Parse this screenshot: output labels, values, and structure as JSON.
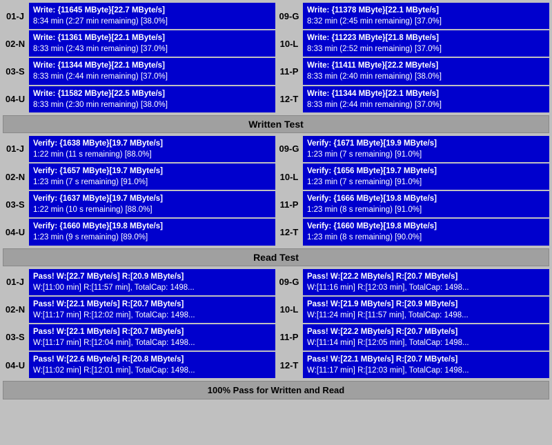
{
  "sections": {
    "write_test": {
      "header": "Written Test",
      "left_devices": [
        {
          "label": "01-J",
          "line1": "Write: {11645 MByte}[22.7 MByte/s]",
          "line2": "8:34 min (2:27 min remaining)  [38.0%]"
        },
        {
          "label": "02-N",
          "line1": "Write: {11361 MByte}[22.1 MByte/s]",
          "line2": "8:33 min (2:43 min remaining)  [37.0%]"
        },
        {
          "label": "03-S",
          "line1": "Write: {11344 MByte}[22.1 MByte/s]",
          "line2": "8:33 min (2:44 min remaining)  [37.0%]"
        },
        {
          "label": "04-U",
          "line1": "Write: {11582 MByte}[22.5 MByte/s]",
          "line2": "8:33 min (2:30 min remaining)  [38.0%]"
        }
      ],
      "right_devices": [
        {
          "label": "09-G",
          "line1": "Write: {11378 MByte}[22.1 MByte/s]",
          "line2": "8:32 min (2:45 min remaining)  [37.0%]"
        },
        {
          "label": "10-L",
          "line1": "Write: {11223 MByte}[21.8 MByte/s]",
          "line2": "8:33 min (2:52 min remaining)  [37.0%]"
        },
        {
          "label": "11-P",
          "line1": "Write: {11411 MByte}[22.2 MByte/s]",
          "line2": "8:33 min (2:40 min remaining)  [38.0%]"
        },
        {
          "label": "12-T",
          "line1": "Write: {11344 MByte}[22.1 MByte/s]",
          "line2": "8:33 min (2:44 min remaining)  [37.0%]"
        }
      ]
    },
    "verify_test": {
      "left_devices": [
        {
          "label": "01-J",
          "line1": "Verify: {1638 MByte}[19.7 MByte/s]",
          "line2": "1:22 min (11 s remaining)   [88.0%]"
        },
        {
          "label": "02-N",
          "line1": "Verify: {1657 MByte}[19.7 MByte/s]",
          "line2": "1:23 min (7 s remaining)   [91.0%]"
        },
        {
          "label": "03-S",
          "line1": "Verify: {1637 MByte}[19.7 MByte/s]",
          "line2": "1:22 min (10 s remaining)   [88.0%]"
        },
        {
          "label": "04-U",
          "line1": "Verify: {1660 MByte}[19.8 MByte/s]",
          "line2": "1:23 min (9 s remaining)   [89.0%]"
        }
      ],
      "right_devices": [
        {
          "label": "09-G",
          "line1": "Verify: {1671 MByte}[19.9 MByte/s]",
          "line2": "1:23 min (7 s remaining)   [91.0%]"
        },
        {
          "label": "10-L",
          "line1": "Verify: {1656 MByte}[19.7 MByte/s]",
          "line2": "1:23 min (7 s remaining)   [91.0%]"
        },
        {
          "label": "11-P",
          "line1": "Verify: {1666 MByte}[19.8 MByte/s]",
          "line2": "1:23 min (8 s remaining)   [91.0%]"
        },
        {
          "label": "12-T",
          "line1": "Verify: {1660 MByte}[19.8 MByte/s]",
          "line2": "1:23 min (8 s remaining)   [90.0%]"
        }
      ]
    },
    "read_test": {
      "header": "Read Test",
      "left_devices": [
        {
          "label": "01-J",
          "line1": "Pass! W:[22.7 MByte/s] R:[20.9 MByte/s]",
          "line2": "W:[11:00 min] R:[11:57 min], TotalCap: 1498..."
        },
        {
          "label": "02-N",
          "line1": "Pass! W:[22.1 MByte/s] R:[20.7 MByte/s]",
          "line2": "W:[11:17 min] R:[12:02 min], TotalCap: 1498..."
        },
        {
          "label": "03-S",
          "line1": "Pass! W:[22.1 MByte/s] R:[20.7 MByte/s]",
          "line2": "W:[11:17 min] R:[12:04 min], TotalCap: 1498..."
        },
        {
          "label": "04-U",
          "line1": "Pass! W:[22.6 MByte/s] R:[20.8 MByte/s]",
          "line2": "W:[11:02 min] R:[12:01 min], TotalCap: 1498..."
        }
      ],
      "right_devices": [
        {
          "label": "09-G",
          "line1": "Pass! W:[22.2 MByte/s] R:[20.7 MByte/s]",
          "line2": "W:[11:16 min] R:[12:03 min], TotalCap: 1498..."
        },
        {
          "label": "10-L",
          "line1": "Pass! W:[21.9 MByte/s] R:[20.9 MByte/s]",
          "line2": "W:[11:24 min] R:[11:57 min], TotalCap: 1498..."
        },
        {
          "label": "11-P",
          "line1": "Pass! W:[22.2 MByte/s] R:[20.7 MByte/s]",
          "line2": "W:[11:14 min] R:[12:05 min], TotalCap: 1498..."
        },
        {
          "label": "12-T",
          "line1": "Pass! W:[22.1 MByte/s] R:[20.7 MByte/s]",
          "line2": "W:[11:17 min] R:[12:03 min], TotalCap: 1498..."
        }
      ]
    }
  },
  "footer": "100% Pass for Written and Read",
  "headers": {
    "written_test": "Written Test",
    "read_test": "Read Test"
  }
}
